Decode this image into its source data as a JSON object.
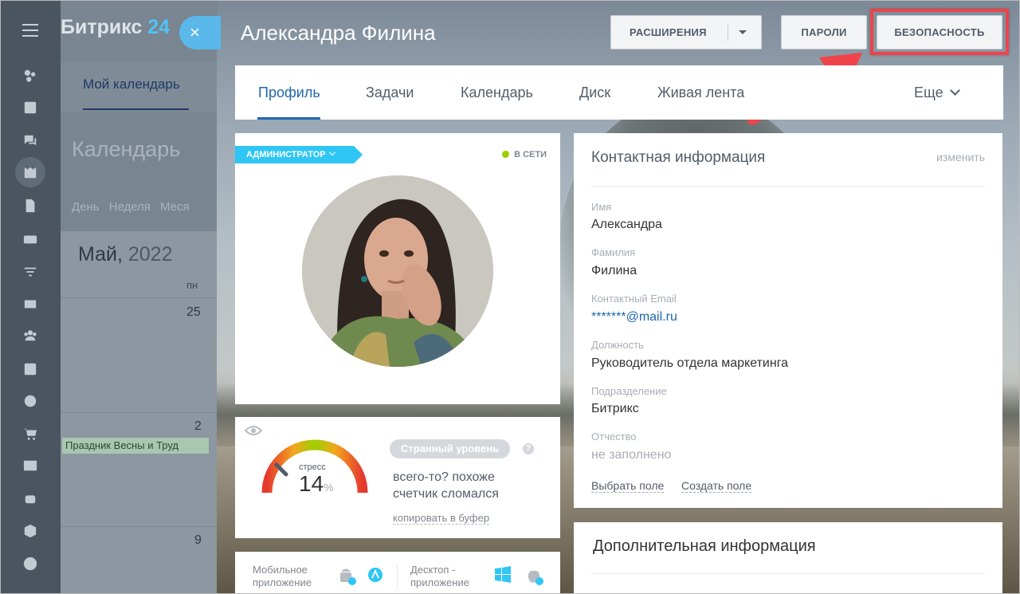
{
  "app": {
    "logo_main": "Битрикс",
    "logo_num": "24"
  },
  "background_calendar": {
    "tab": "Мой календарь",
    "title": "Календарь",
    "views": [
      "День",
      "Неделя",
      "Меся"
    ],
    "month": "Май,",
    "year": "2022",
    "dow": "пн",
    "days": [
      "25",
      "2",
      "9"
    ],
    "event": "Праздник Весны и Труд"
  },
  "slider": {
    "close_icon": "×",
    "person_name": "Александра Филина",
    "buttons": {
      "extensions": "РАСШИРЕНИЯ",
      "passwords": "ПАРОЛИ",
      "security": "БЕЗОПАСНОСТЬ"
    },
    "tabs": [
      "Профиль",
      "Задачи",
      "Календарь",
      "Диск",
      "Живая лента"
    ],
    "more": "Еще"
  },
  "profile": {
    "role_badge": "АДМИНИСТРАТОР",
    "status": "В СЕТИ",
    "status_color": "#9dcf00"
  },
  "stress": {
    "label": "стресс",
    "value": "14",
    "unit": "%",
    "badge": "Странный уровень",
    "help": "?",
    "text": "всего-то? похоже счетчик сломался",
    "copy_link": "копировать в буфер"
  },
  "apps": {
    "mobile": "Мобильное приложение",
    "desktop": "Десктоп - приложение"
  },
  "contact": {
    "title": "Контактная информация",
    "edit": "изменить",
    "fields": [
      {
        "label": "Имя",
        "value": "Александра"
      },
      {
        "label": "Фамилия",
        "value": "Филина"
      },
      {
        "label": "Контактный Email",
        "value": "*******@mail.ru"
      },
      {
        "label": "Должность",
        "value": "Руководитель отдела маркетинга"
      },
      {
        "label": "Подразделение",
        "value": "Битрикс"
      },
      {
        "label": "Отчество",
        "value": "не заполнено"
      }
    ],
    "choose_field": "Выбрать поле",
    "create_field": "Создать поле"
  },
  "extra": {
    "title": "Дополнительная информация"
  },
  "colors": {
    "accent": "#2067b0",
    "highlight": "#f0434a",
    "badge": "#2fc6f6"
  }
}
